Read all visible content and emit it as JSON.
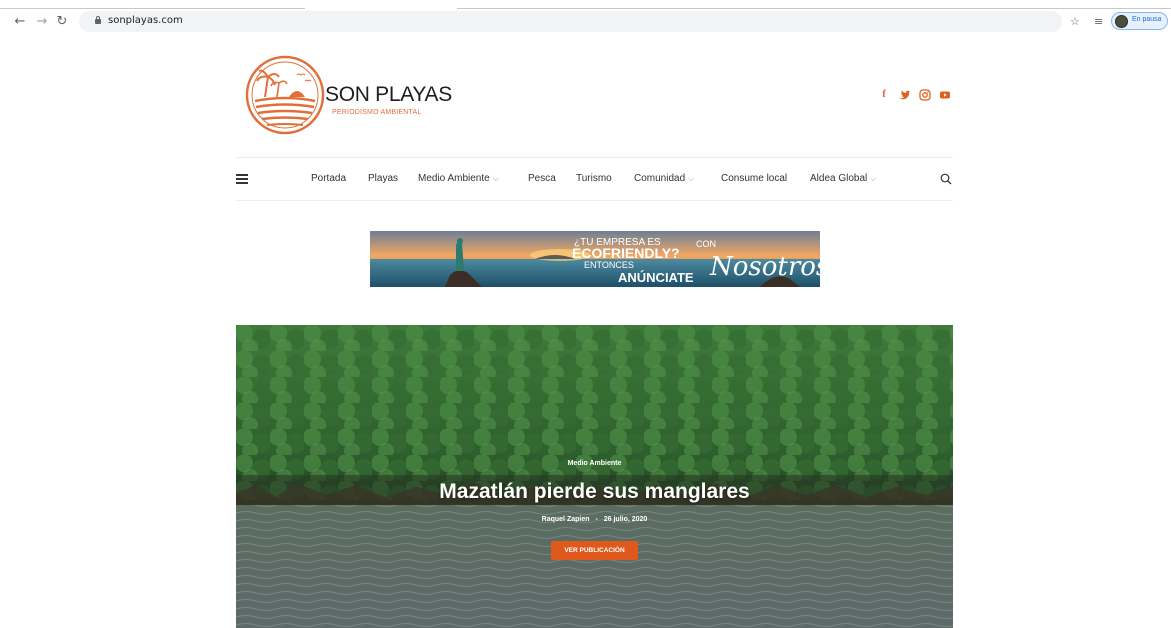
{
  "browser": {
    "url": "sonplayas.com",
    "profile_status": "En pausa"
  },
  "site": {
    "brand_name": "SON PLAYAS",
    "brand_tagline": "PERIODISMO AMBIENTAL",
    "accent_color": "#e0601e",
    "socials": [
      "facebook-icon",
      "twitter-icon",
      "instagram-icon",
      "youtube-icon"
    ]
  },
  "nav": {
    "items": [
      {
        "label": "Portada",
        "dropdown": false
      },
      {
        "label": "Playas",
        "dropdown": false
      },
      {
        "label": "Medio Ambiente",
        "dropdown": true
      },
      {
        "label": "Pesca",
        "dropdown": false
      },
      {
        "label": "Turismo",
        "dropdown": false
      },
      {
        "label": "Comunidad",
        "dropdown": true
      },
      {
        "label": "Consume local",
        "dropdown": false
      },
      {
        "label": "Aldea Global",
        "dropdown": true
      }
    ]
  },
  "ad": {
    "line1": "¿TU EMPRESA ES",
    "line2": "ECOFRIENDLY?",
    "line3": "ENTONCES",
    "line4": "ANÚNCIATE",
    "con": "CON",
    "script": "Nosotros"
  },
  "hero": {
    "category": "Medio Ambiente",
    "title": "Mazatlán pierde sus manglares",
    "author": "Raquel Zapien",
    "date": "26 julio, 2020",
    "button": "VER PUBLICACIÓN"
  }
}
